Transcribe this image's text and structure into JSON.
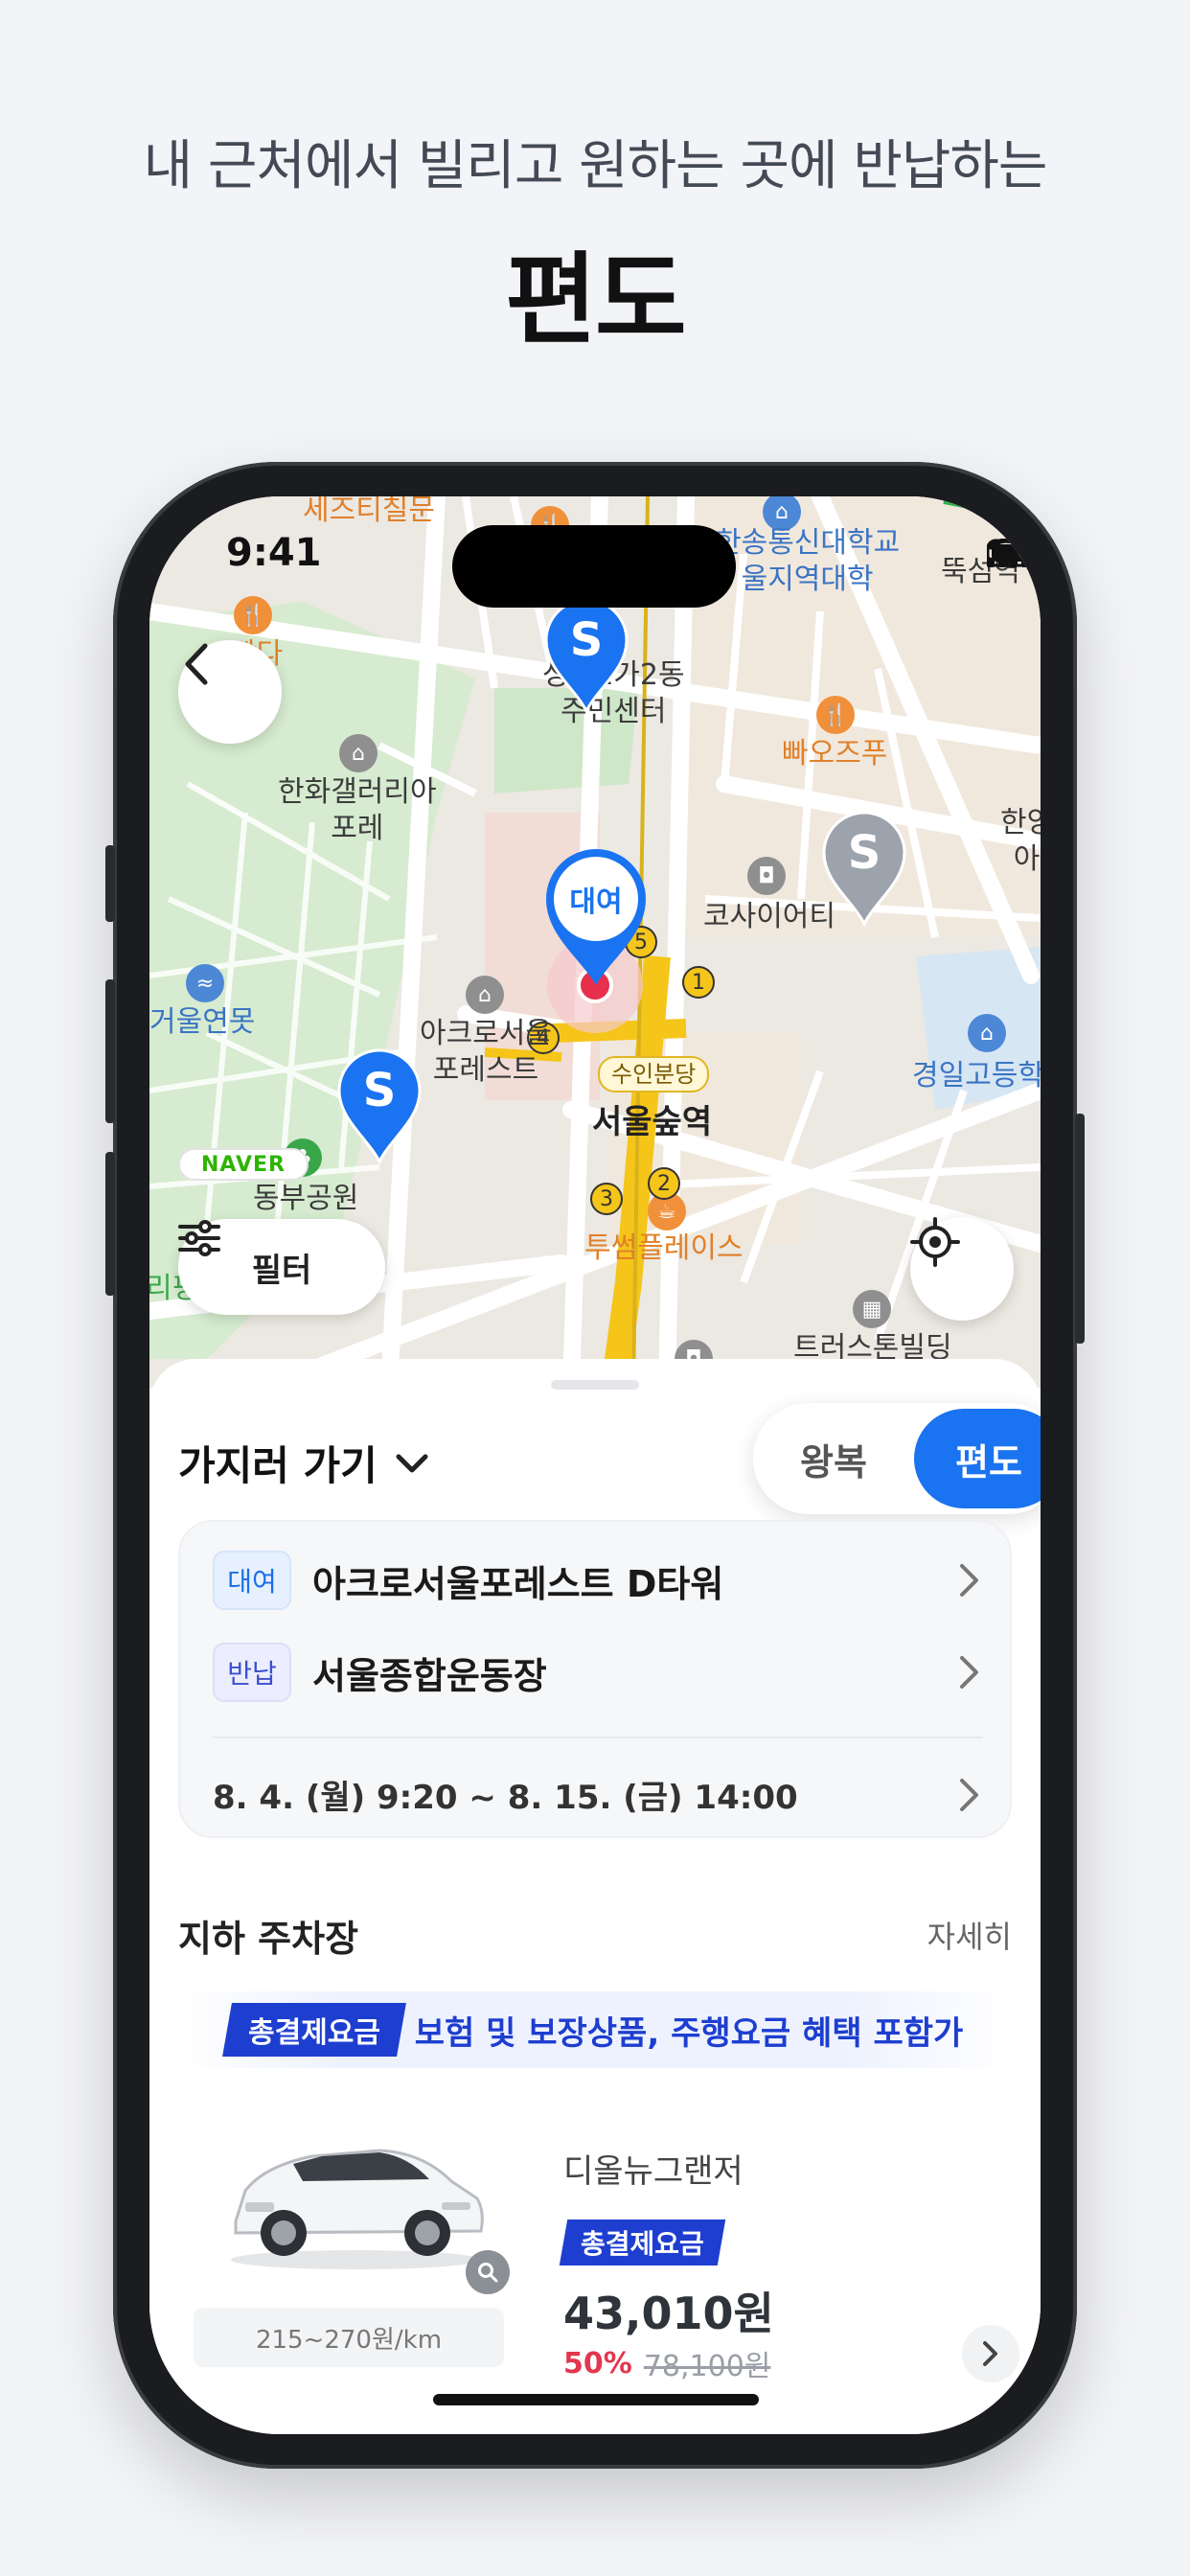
{
  "headline": {
    "subtitle": "내 근처에서 빌리고 원하는 곳에 반납하는",
    "title": "편도"
  },
  "status_bar": {
    "time": "9:41",
    "icons": [
      "signal-icon",
      "wifi-icon",
      "battery-icon"
    ]
  },
  "map": {
    "labels": {
      "top_restaurant": "세즈티칠문",
      "bakery_top_left": "빵다",
      "community_center": "성수1가2동\n주민센터",
      "gallery": "한화갤러리아\n포레",
      "bakery": "빠오즈푸",
      "company": "코사이어티",
      "right_partial": "한양\n아",
      "mirror_pond": "거울연못",
      "acro_forest": "아크로서울\n포레스트",
      "bundang_line": "수인분당",
      "station": "서울숲역",
      "east_park": "동부공원",
      "cafe": "투썸플레이스",
      "school": "경일고등학",
      "trust_building": "트러스톤빌딩",
      "university": "한송통신대학교\n울지역대학",
      "ttukseom": "뚝섬역",
      "naver": "NAVER",
      "left_edge": "리핑"
    },
    "exits": [
      "1",
      "2",
      "3",
      "4",
      "5"
    ],
    "markers": {
      "station_marker": "S",
      "rental_marker": "대여"
    },
    "colors": {
      "marker_blue": "#1a73f0",
      "marker_gray": "#9ca3ad",
      "subway_yellow": "#f5c51a",
      "park_green": "#cfe7c9"
    }
  },
  "filter_button": {
    "label": "필터",
    "icon": "sliders-icon"
  },
  "sheet": {
    "destination_dropdown": "가지러 가기",
    "trip_toggle": {
      "round_trip": "왕복",
      "one_way": "편도",
      "selected": "편도"
    },
    "route": {
      "pickup_tag": "대여",
      "pickup_location": "아크로서울포레스트 D타워",
      "return_tag": "반납",
      "return_location": "서울종합운동장",
      "period": "8. 4. (월) 9:20 ~ 8. 15. (금) 14:00"
    },
    "parking": {
      "title": "지하 주차장",
      "details_link": "자세히"
    },
    "promo": {
      "badge": "총결제요금",
      "text": "보험 및 보장상품, 주행요금 혜택 포함가"
    },
    "car": {
      "name": "디올뉴그랜저",
      "badge": "총결제요금",
      "price": "43,010원",
      "discount_percent": "50%",
      "original_price": "78,100원",
      "km_rate": "215~270원/km"
    }
  }
}
